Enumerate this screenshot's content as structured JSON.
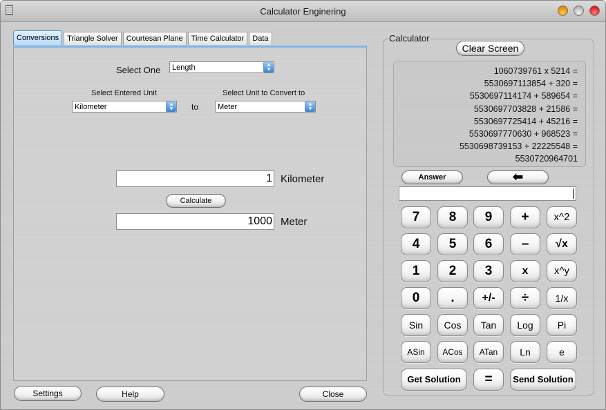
{
  "window": {
    "title": "Calculator Enginering",
    "controls": [
      "minimize",
      "zoom",
      "close"
    ]
  },
  "tabs": [
    {
      "label": "Conversions",
      "active": true
    },
    {
      "label": "Triangle Solver",
      "active": false
    },
    {
      "label": "Courtesan Plane",
      "active": false
    },
    {
      "label": "Time Calculator",
      "active": false
    },
    {
      "label": "Data",
      "active": false
    }
  ],
  "conversions": {
    "select_one_label": "Select One",
    "category_value": "Length",
    "from_label": "Select Entered Unit",
    "from_value": "Kilometer",
    "to_word": "to",
    "to_label": "Select Unit to Convert to",
    "to_value": "Meter",
    "input_value": "1",
    "input_unit": "Kilometer",
    "calculate_label": "Calculate",
    "output_value": "1000",
    "output_unit": "Meter"
  },
  "footer": {
    "settings_label": "Settings",
    "help_label": "Help",
    "close_label": "Close"
  },
  "calculator": {
    "group_label": "Calculator",
    "clear_label": "Clear Screen",
    "display_lines": [
      "1060739761 x 5214 =",
      "5530697113854 + 320 =",
      "5530697114174 + 589654 =",
      "5530697703828 + 21586 =",
      "5530697725414 + 45216 =",
      "5530697770630 + 968523 =",
      "5530698739153 + 22225548 =",
      "5530720964701"
    ],
    "answer_label": "Answer",
    "backspace_symbol": "⬅",
    "entry_value": "",
    "keys": {
      "row1": [
        "7",
        "8",
        "9",
        "+",
        "x^2"
      ],
      "row2": [
        "4",
        "5",
        "6",
        "–",
        "√x"
      ],
      "row3": [
        "1",
        "2",
        "3",
        "x",
        "x^y"
      ],
      "row4": [
        "0",
        ".",
        "+/-",
        "÷",
        "1/x"
      ],
      "row5": [
        "Sin",
        "Cos",
        "Tan",
        "Log",
        "Pi"
      ],
      "row6": [
        "ASin",
        "ACos",
        "ATan",
        "Ln",
        "e"
      ],
      "row7": [
        "Get Solution",
        "=",
        "Send Solution"
      ]
    }
  }
}
